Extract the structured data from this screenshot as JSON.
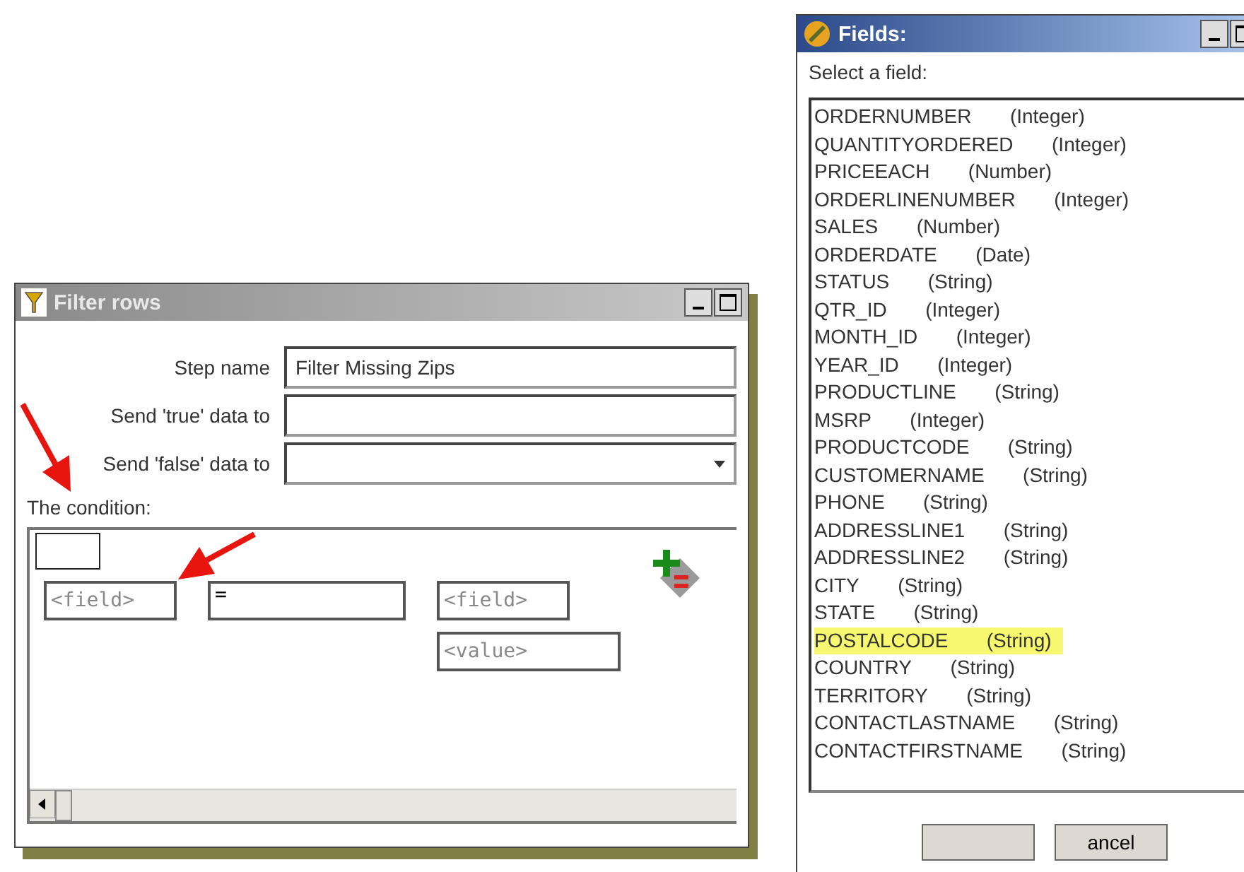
{
  "filter_window": {
    "title": "Filter rows",
    "form": [
      {
        "label": "Step name",
        "value": "Filter Missing Zips",
        "kind": "text"
      },
      {
        "label": "Send 'true' data to",
        "kind": "text"
      },
      {
        "label": "Send 'false' data to",
        "kind": "dropdown"
      }
    ],
    "condition_label": "The condition:",
    "condition": {
      "left_field": "<field>",
      "operator": "=",
      "right_field": "<field>",
      "value": "<value>"
    }
  },
  "fields_window": {
    "title": "Fields:",
    "prompt": "Select a field:",
    "fields": [
      {
        "name": "ORDERNUMBER",
        "type": "(Integer)",
        "selected": false
      },
      {
        "name": "QUANTITYORDERED",
        "type": "(Integer)",
        "selected": false
      },
      {
        "name": "PRICEEACH",
        "type": "(Number)",
        "selected": false
      },
      {
        "name": "ORDERLINENUMBER",
        "type": "(Integer)",
        "selected": false
      },
      {
        "name": "SALES",
        "type": "(Number)",
        "selected": false
      },
      {
        "name": "ORDERDATE",
        "type": "(Date)",
        "selected": false
      },
      {
        "name": "STATUS",
        "type": "(String)",
        "selected": false
      },
      {
        "name": "QTR_ID",
        "type": "(Integer)",
        "selected": false
      },
      {
        "name": "MONTH_ID",
        "type": "(Integer)",
        "selected": false
      },
      {
        "name": "YEAR_ID",
        "type": "(Integer)",
        "selected": false
      },
      {
        "name": "PRODUCTLINE",
        "type": "(String)",
        "selected": false
      },
      {
        "name": "MSRP",
        "type": "(Integer)",
        "selected": false
      },
      {
        "name": "PRODUCTCODE",
        "type": "(String)",
        "selected": false
      },
      {
        "name": "CUSTOMERNAME",
        "type": "(String)",
        "selected": false
      },
      {
        "name": "PHONE",
        "type": "(String)",
        "selected": false
      },
      {
        "name": "ADDRESSLINE1",
        "type": "(String)",
        "selected": false
      },
      {
        "name": "ADDRESSLINE2",
        "type": "(String)",
        "selected": false
      },
      {
        "name": "CITY",
        "type": "(String)",
        "selected": false
      },
      {
        "name": "STATE",
        "type": "(String)",
        "selected": false
      },
      {
        "name": "POSTALCODE",
        "type": "(String)",
        "selected": true
      },
      {
        "name": "COUNTRY",
        "type": "(String)",
        "selected": false
      },
      {
        "name": "TERRITORY",
        "type": "(String)",
        "selected": false
      },
      {
        "name": "CONTACTLASTNAME",
        "type": "(String)",
        "selected": false
      },
      {
        "name": "CONTACTFIRSTNAME",
        "type": "(String)",
        "selected": false
      }
    ],
    "buttons": [
      "ancel"
    ]
  }
}
